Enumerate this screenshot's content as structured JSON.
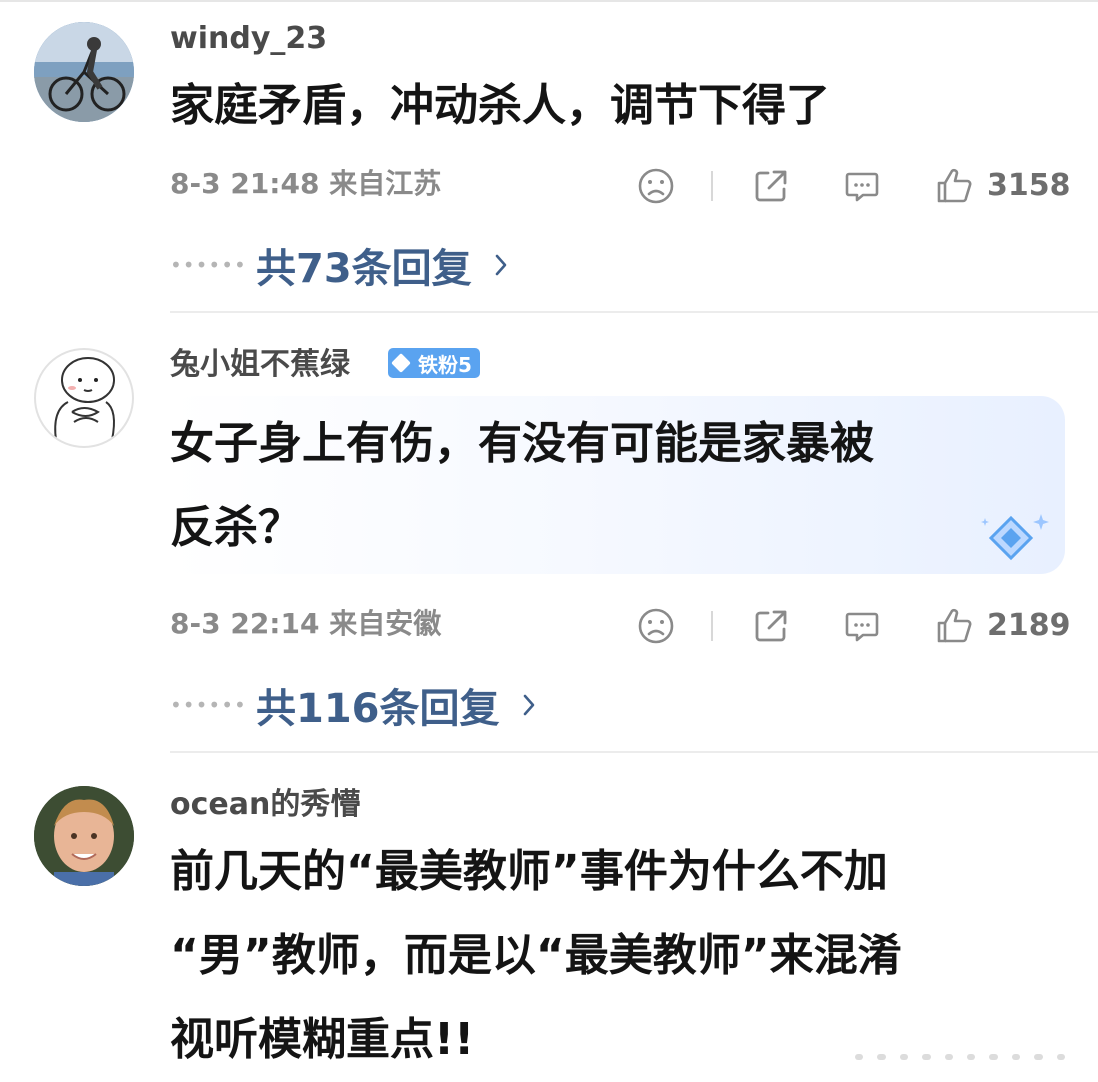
{
  "comments": [
    {
      "username": "windy_23",
      "avatar": "avatar-bicycle-photo",
      "body_lines": [
        "家庭矛盾，冲动杀人，调节下得了"
      ],
      "meta": "8-3 21:48 来自江苏",
      "likes": "3158",
      "replies": "共73条回复"
    },
    {
      "username": "兔小姐不蕉绿",
      "avatar": "avatar-cartoon-sketch",
      "badge": "铁粉5",
      "body_lines": [
        "女子身上有伤，有没有可能是家暴被",
        "反杀？"
      ],
      "meta": "8-3 22:14 来自安徽",
      "likes": "2189",
      "replies": "共116条回复"
    },
    {
      "username": "ocean的秀懵",
      "avatar": "avatar-child-photo",
      "body_lines": [
        "前几天的“最美教师”事件为什么不加",
        "“男”教师，而是以“最美教师”来混淆",
        "视听模糊重点!!"
      ]
    }
  ],
  "icons": {
    "dislike": "frown-face-icon",
    "share": "share-icon",
    "comment": "comment-bubble-icon",
    "like": "thumbs-up-icon",
    "more": "chevron-right-icon"
  },
  "colors": {
    "reply_link": "#3f5f8a",
    "badge": "#5aa3f0",
    "meta_text": "#8a8a8a"
  }
}
